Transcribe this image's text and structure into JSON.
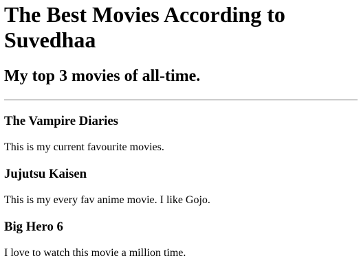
{
  "page": {
    "title": "The Best Movies According to Suvedhaa",
    "subtitle": "My top 3 movies of all-time."
  },
  "movies": [
    {
      "name": "The Vampire Diaries",
      "description": "This is my current favourite movies."
    },
    {
      "name": "Jujutsu Kaisen",
      "description": "This is my every fav anime movie. I like Gojo."
    },
    {
      "name": "Big Hero 6",
      "description": "I love to watch this movie a million time."
    }
  ]
}
